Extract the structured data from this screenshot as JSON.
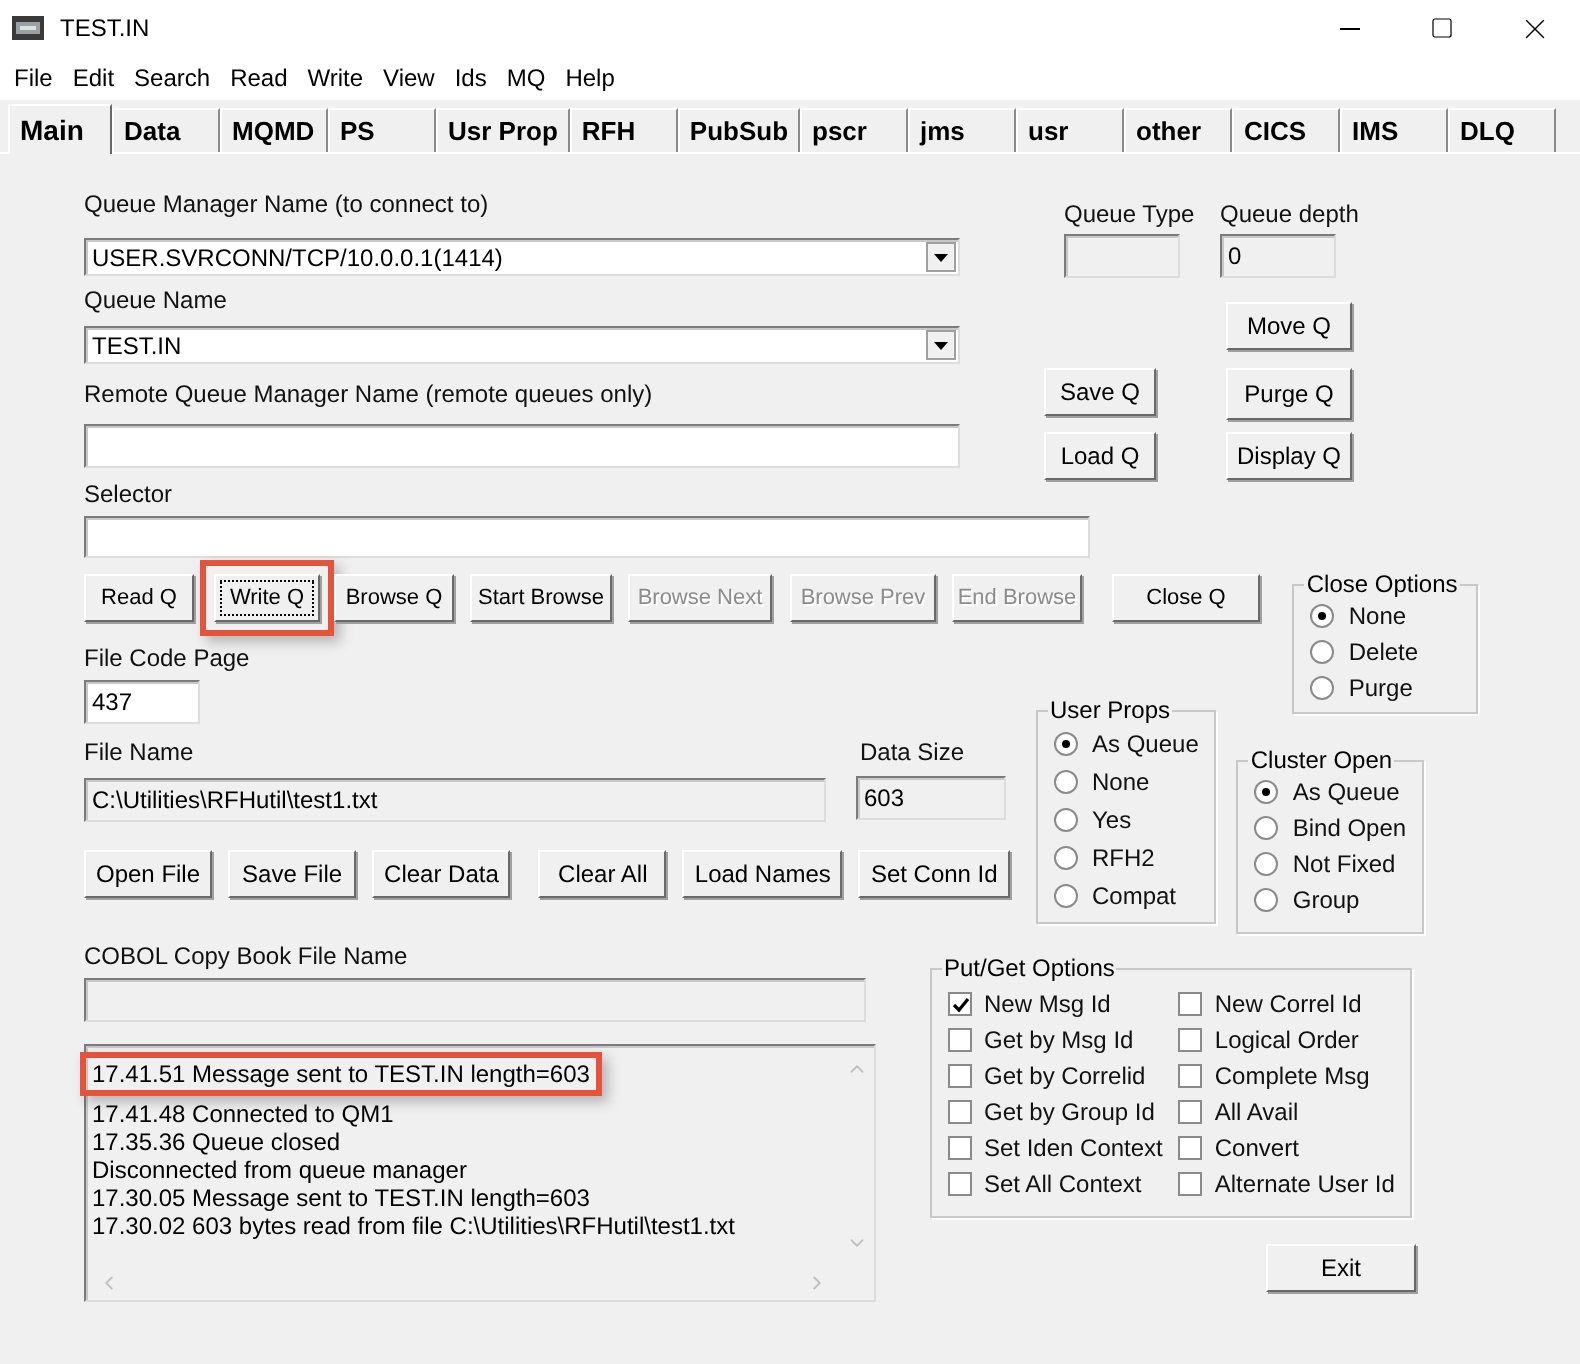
{
  "window": {
    "title": "TEST.IN"
  },
  "menu": [
    "File",
    "Edit",
    "Search",
    "Read",
    "Write",
    "View",
    "Ids",
    "MQ",
    "Help"
  ],
  "tabs": [
    {
      "label": "Main",
      "selected": true
    },
    {
      "label": "Data",
      "selected": false
    },
    {
      "label": "MQMD",
      "selected": false
    },
    {
      "label": "PS",
      "selected": false
    },
    {
      "label": "Usr Prop",
      "selected": false
    },
    {
      "label": "RFH",
      "selected": false
    },
    {
      "label": "PubSub",
      "selected": false
    },
    {
      "label": "pscr",
      "selected": false
    },
    {
      "label": "jms",
      "selected": false
    },
    {
      "label": "usr",
      "selected": false
    },
    {
      "label": "other",
      "selected": false
    },
    {
      "label": "CICS",
      "selected": false
    },
    {
      "label": "IMS",
      "selected": false
    },
    {
      "label": "DLQ",
      "selected": false
    }
  ],
  "queue_manager": {
    "label": "Queue Manager Name (to connect to)",
    "value": "USER.SVRCONN/TCP/10.0.0.1(1414)"
  },
  "queue_name": {
    "label": "Queue Name",
    "value": "TEST.IN"
  },
  "remote_queue_manager": {
    "label": "Remote Queue Manager Name (remote queues only)",
    "read_only": false
  },
  "selector": {
    "label": "Selector",
    "read_only": false
  },
  "queue_type": {
    "label": "Queue Type",
    "read_only": true
  },
  "queue_depth": {
    "label": "Queue depth",
    "value": "0",
    "read_only": true
  },
  "queue_buttons": {
    "move": "Move Q",
    "save": "Save Q",
    "purge": "Purge Q",
    "load": "Load Q",
    "display": "Display Q"
  },
  "action_buttons": [
    {
      "label": "Read Q",
      "disabled": false,
      "highlighted": false
    },
    {
      "label": "Write Q",
      "disabled": false,
      "highlighted": true
    },
    {
      "label": "Browse Q",
      "disabled": false,
      "highlighted": false
    },
    {
      "label": "Start Browse",
      "disabled": false,
      "highlighted": false
    },
    {
      "label": "Browse Next",
      "disabled": true,
      "highlighted": false
    },
    {
      "label": "Browse Prev",
      "disabled": true,
      "highlighted": false
    },
    {
      "label": "End Browse",
      "disabled": true,
      "highlighted": false
    },
    {
      "label": "Close Q",
      "disabled": false,
      "highlighted": false
    }
  ],
  "close_options": {
    "title": "Close Options",
    "options": [
      {
        "label": "None",
        "selected": true
      },
      {
        "label": "Delete",
        "selected": false
      },
      {
        "label": "Purge",
        "selected": false
      }
    ]
  },
  "file_code_page": {
    "label": "File Code Page",
    "value": "437",
    "read_only": false
  },
  "file_name": {
    "label": "File Name",
    "value": "C:\\Utilities\\RFHutil\\test1.txt",
    "read_only": true
  },
  "data_size": {
    "label": "Data Size",
    "value": "603",
    "read_only": true
  },
  "user_props": {
    "title": "User Props",
    "options": [
      {
        "label": "As Queue",
        "selected": true
      },
      {
        "label": "None",
        "selected": false
      },
      {
        "label": "Yes",
        "selected": false
      },
      {
        "label": "RFH2",
        "selected": false
      },
      {
        "label": "Compat",
        "selected": false
      }
    ]
  },
  "cluster_open": {
    "title": "Cluster Open",
    "options": [
      {
        "label": "As Queue",
        "selected": true
      },
      {
        "label": "Bind Open",
        "selected": false
      },
      {
        "label": "Not Fixed",
        "selected": false
      },
      {
        "label": "Group",
        "selected": false
      }
    ]
  },
  "file_buttons": [
    "Open File",
    "Save File",
    "Clear Data",
    "Clear All",
    "Load Names",
    "Set Conn Id"
  ],
  "cobol_copybook": {
    "label": "COBOL Copy Book File Name",
    "read_only": true
  },
  "log": [
    {
      "text": "17.41.51 Message sent to TEST.IN length=603",
      "highlighted": true
    },
    {
      "text": "17.41.48 Connected to QM1",
      "highlighted": false
    },
    {
      "text": "17.35.36 Queue closed",
      "highlighted": false
    },
    {
      "text": "Disconnected from queue manager",
      "highlighted": false
    },
    {
      "text": "17.30.05 Message sent to TEST.IN length=603",
      "highlighted": false
    },
    {
      "text": "17.30.02 603 bytes read from file C:\\Utilities\\RFHutil\\test1.txt",
      "highlighted": false
    }
  ],
  "put_get_options": {
    "title": "Put/Get Options",
    "options": [
      {
        "label": "New Msg Id",
        "checked": true
      },
      {
        "label": "Get by Msg Id",
        "checked": false
      },
      {
        "label": "Get by Correlid",
        "checked": false
      },
      {
        "label": "Get by Group Id",
        "checked": false
      },
      {
        "label": "Set Iden Context",
        "checked": false
      },
      {
        "label": "Set All Context",
        "checked": false
      },
      {
        "label": "New Correl Id",
        "checked": false
      },
      {
        "label": "Logical Order",
        "checked": false
      },
      {
        "label": "Complete Msg",
        "checked": false
      },
      {
        "label": "All Avail",
        "checked": false
      },
      {
        "label": "Convert",
        "checked": false
      },
      {
        "label": "Alternate User Id",
        "checked": false
      }
    ]
  },
  "exit_button": "Exit"
}
